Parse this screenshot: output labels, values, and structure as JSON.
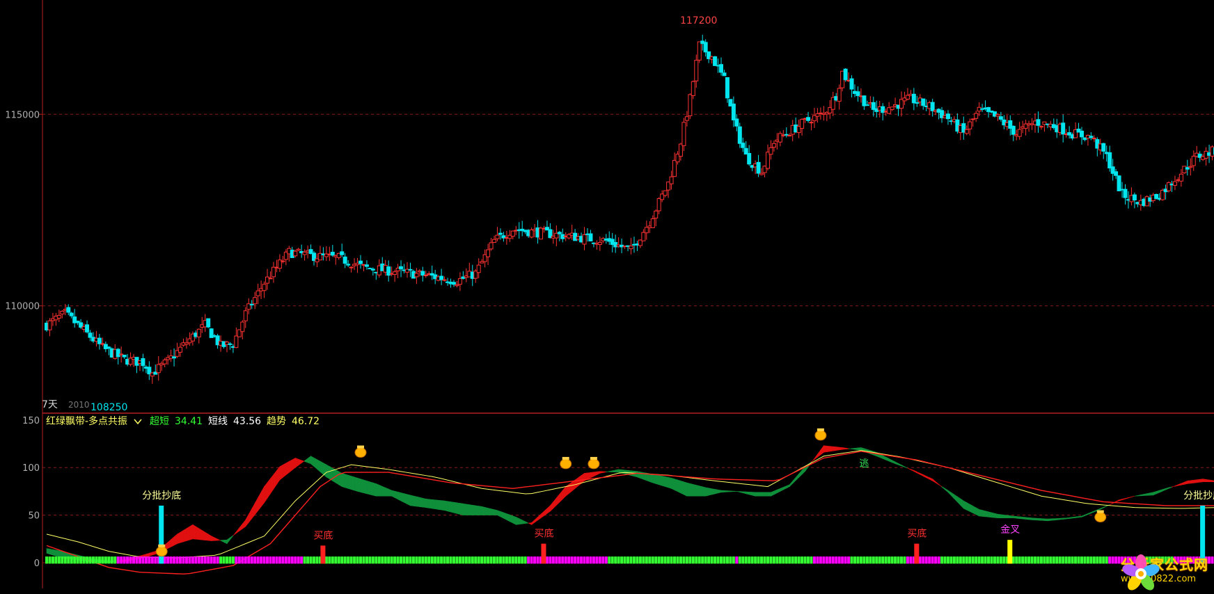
{
  "main_panel": {
    "y_ticks": [
      "115000",
      "110000"
    ],
    "high_label": "117200",
    "low_label": "108250",
    "period_label": "7天",
    "code_fragment": "2010"
  },
  "indicator_panel": {
    "y_ticks": [
      "150",
      "100",
      "50",
      "0"
    ],
    "indicator_name": "红绿飘带-多点共振",
    "readouts": [
      {
        "label": "超短",
        "value": "34.41",
        "label_color": "#33ff33",
        "value_color": "#33ff33"
      },
      {
        "label": "短线",
        "value": "43.56",
        "label_color": "#ffffff",
        "value_color": "#ffffff"
      },
      {
        "label": "趋势",
        "value": "46.72",
        "label_color": "#ffff66",
        "value_color": "#ffff66"
      }
    ],
    "annotations": {
      "fenpi_chaodi": "分批抄底",
      "maidi": "买底",
      "jincha": "金叉",
      "tao": "逃"
    }
  },
  "watermark": {
    "title": "分析家公式网",
    "url": "www.70822.com"
  },
  "colors": {
    "up_candle": "#ff3232",
    "down_candle": "#00e5ee",
    "grid": "#8b1a1a",
    "red_band": "#e01010",
    "green_band": "#0f8f3a",
    "trend_line": "#ffff66",
    "bar_magenta": "#ff00ff",
    "bar_green": "#33ff33"
  },
  "chart_data": {
    "type": "candlestick",
    "y_range": [
      107200,
      117800
    ],
    "indicator_range": [
      -10,
      150
    ],
    "price_path": [
      [
        0,
        109500
      ],
      [
        6,
        109800
      ],
      [
        12,
        109350
      ],
      [
        18,
        108900
      ],
      [
        25,
        108600
      ],
      [
        31,
        108520
      ],
      [
        34,
        108250
      ],
      [
        39,
        108550
      ],
      [
        45,
        109050
      ],
      [
        51,
        109500
      ],
      [
        56,
        108950
      ],
      [
        60,
        109000
      ],
      [
        64,
        109800
      ],
      [
        70,
        110600
      ],
      [
        78,
        111400
      ],
      [
        86,
        111300
      ],
      [
        94,
        111250
      ],
      [
        102,
        111000
      ],
      [
        112,
        110900
      ],
      [
        122,
        110800
      ],
      [
        132,
        110650
      ],
      [
        138,
        110850
      ],
      [
        144,
        111700
      ],
      [
        150,
        112000
      ],
      [
        160,
        111900
      ],
      [
        170,
        111800
      ],
      [
        180,
        111700
      ],
      [
        188,
        111450
      ],
      [
        194,
        112200
      ],
      [
        200,
        113200
      ],
      [
        204,
        114300
      ],
      [
        207,
        115400
      ],
      [
        210,
        116800
      ],
      [
        214,
        116500
      ],
      [
        218,
        115900
      ],
      [
        221,
        114800
      ],
      [
        225,
        113900
      ],
      [
        230,
        113500
      ],
      [
        234,
        114300
      ],
      [
        240,
        114600
      ],
      [
        246,
        114900
      ],
      [
        250,
        115000
      ],
      [
        254,
        115500
      ],
      [
        256,
        116100
      ],
      [
        260,
        115600
      ],
      [
        266,
        115100
      ],
      [
        272,
        115200
      ],
      [
        278,
        115400
      ],
      [
        284,
        115200
      ],
      [
        290,
        114900
      ],
      [
        295,
        114500
      ],
      [
        300,
        115100
      ],
      [
        306,
        114900
      ],
      [
        312,
        114500
      ],
      [
        318,
        114800
      ],
      [
        324,
        114700
      ],
      [
        330,
        114500
      ],
      [
        336,
        114400
      ],
      [
        341,
        113900
      ],
      [
        346,
        112900
      ],
      [
        352,
        112700
      ],
      [
        358,
        112900
      ],
      [
        364,
        113400
      ],
      [
        370,
        113900
      ],
      [
        376,
        114050
      ]
    ],
    "indicator_lines": {
      "red_fast": [
        [
          0,
          10
        ],
        [
          5,
          5
        ],
        [
          10,
          3
        ],
        [
          15,
          0
        ],
        [
          20,
          0
        ],
        [
          25,
          3
        ],
        [
          31,
          8
        ],
        [
          36,
          13
        ],
        [
          42,
          30
        ],
        [
          47,
          40
        ],
        [
          53,
          28
        ],
        [
          58,
          20
        ],
        [
          64,
          45
        ],
        [
          70,
          80
        ],
        [
          75,
          101
        ],
        [
          80,
          110
        ],
        [
          85,
          104
        ],
        [
          90,
          90
        ],
        [
          95,
          80
        ],
        [
          100,
          75
        ],
        [
          106,
          70
        ],
        [
          111,
          70
        ],
        [
          117,
          60
        ],
        [
          122,
          58
        ],
        [
          128,
          55
        ],
        [
          134,
          50
        ],
        [
          140,
          50
        ],
        [
          145,
          50
        ],
        [
          151,
          40
        ],
        [
          156,
          42
        ],
        [
          162,
          60
        ],
        [
          167,
          80
        ],
        [
          173,
          94
        ],
        [
          178,
          96
        ],
        [
          184,
          95
        ],
        [
          190,
          90
        ],
        [
          195,
          84
        ],
        [
          201,
          78
        ],
        [
          206,
          70
        ],
        [
          212,
          70
        ],
        [
          217,
          74
        ],
        [
          222,
          75
        ],
        [
          228,
          70
        ],
        [
          233,
          70
        ],
        [
          239,
          80
        ],
        [
          244,
          96
        ],
        [
          250,
          123
        ],
        [
          256,
          121
        ],
        [
          262,
          118
        ],
        [
          267,
          112
        ],
        [
          273,
          104
        ],
        [
          279,
          97
        ],
        [
          285,
          88
        ],
        [
          290,
          74
        ],
        [
          295,
          57
        ],
        [
          300,
          49
        ],
        [
          306,
          47
        ],
        [
          311,
          47
        ],
        [
          317,
          45
        ],
        [
          322,
          44
        ],
        [
          328,
          46
        ],
        [
          333,
          48
        ],
        [
          339,
          56
        ],
        [
          345,
          66
        ],
        [
          350,
          70
        ],
        [
          356,
          71
        ],
        [
          361,
          78
        ],
        [
          367,
          86
        ],
        [
          372,
          88
        ],
        [
          376,
          86
        ]
      ],
      "green_slow": [
        [
          0,
          15
        ],
        [
          5,
          12
        ],
        [
          10,
          8
        ],
        [
          15,
          4
        ],
        [
          20,
          2
        ],
        [
          25,
          1
        ],
        [
          31,
          5
        ],
        [
          36,
          10
        ],
        [
          42,
          20
        ],
        [
          47,
          25
        ],
        [
          53,
          23
        ],
        [
          58,
          24
        ],
        [
          64,
          38
        ],
        [
          70,
          63
        ],
        [
          75,
          87
        ],
        [
          80,
          100
        ],
        [
          85,
          112
        ],
        [
          90,
          103
        ],
        [
          95,
          94
        ],
        [
          100,
          89
        ],
        [
          106,
          83
        ],
        [
          111,
          76
        ],
        [
          117,
          71
        ],
        [
          122,
          67
        ],
        [
          128,
          65
        ],
        [
          134,
          62
        ],
        [
          140,
          59
        ],
        [
          145,
          55
        ],
        [
          151,
          48
        ],
        [
          156,
          40
        ],
        [
          162,
          54
        ],
        [
          167,
          70
        ],
        [
          173,
          86
        ],
        [
          178,
          94
        ],
        [
          184,
          98
        ],
        [
          190,
          96
        ],
        [
          195,
          93
        ],
        [
          201,
          89
        ],
        [
          206,
          84
        ],
        [
          212,
          79
        ],
        [
          217,
          76
        ],
        [
          222,
          75
        ],
        [
          228,
          74
        ],
        [
          233,
          74
        ],
        [
          239,
          82
        ],
        [
          244,
          101
        ],
        [
          250,
          116
        ],
        [
          256,
          119
        ],
        [
          262,
          121
        ],
        [
          267,
          116
        ],
        [
          273,
          106
        ],
        [
          279,
          96
        ],
        [
          285,
          86
        ],
        [
          290,
          76
        ],
        [
          295,
          65
        ],
        [
          300,
          56
        ],
        [
          306,
          51
        ],
        [
          311,
          49
        ],
        [
          317,
          47
        ],
        [
          322,
          46
        ],
        [
          328,
          47
        ],
        [
          333,
          49
        ],
        [
          339,
          57
        ],
        [
          345,
          65
        ],
        [
          350,
          70
        ],
        [
          356,
          74
        ],
        [
          361,
          79
        ],
        [
          367,
          83
        ],
        [
          372,
          85
        ],
        [
          376,
          85
        ]
      ],
      "trend": [
        [
          0,
          30
        ],
        [
          10,
          22
        ],
        [
          20,
          12
        ],
        [
          30,
          6
        ],
        [
          42,
          5
        ],
        [
          55,
          8
        ],
        [
          70,
          28
        ],
        [
          80,
          65
        ],
        [
          90,
          95
        ],
        [
          98,
          103
        ],
        [
          110,
          98
        ],
        [
          125,
          90
        ],
        [
          140,
          78
        ],
        [
          155,
          72
        ],
        [
          170,
          82
        ],
        [
          185,
          95
        ],
        [
          200,
          92
        ],
        [
          215,
          86
        ],
        [
          232,
          80
        ],
        [
          250,
          112
        ],
        [
          262,
          118
        ],
        [
          275,
          111
        ],
        [
          290,
          100
        ],
        [
          305,
          85
        ],
        [
          320,
          70
        ],
        [
          335,
          62
        ],
        [
          350,
          58
        ],
        [
          365,
          57
        ],
        [
          376,
          58
        ]
      ]
    },
    "bars": [
      {
        "x": 37,
        "height": 60,
        "type": "fenpi"
      },
      {
        "x": 89,
        "height": 18,
        "type": "maidi"
      },
      {
        "x": 160,
        "height": 20,
        "type": "maidi"
      },
      {
        "x": 280,
        "height": 20,
        "type": "maidi"
      },
      {
        "x": 310,
        "height": 24,
        "type": "jincha"
      },
      {
        "x": 372,
        "height": 60,
        "type": "fenpi"
      }
    ],
    "money_markers": [
      [
        37,
        6
      ],
      [
        101,
        110
      ],
      [
        167,
        98
      ],
      [
        176,
        98
      ],
      [
        249,
        128
      ],
      [
        339,
        42
      ]
    ]
  }
}
